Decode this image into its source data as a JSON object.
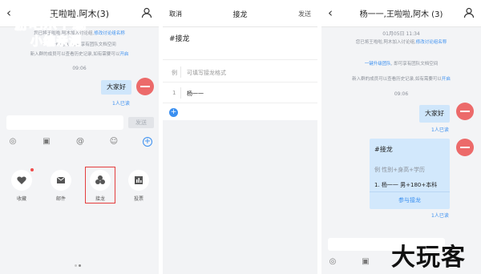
{
  "watermark": {
    "line1": "游吧乐下载",
    "line2": "小编亲测",
    "corner": "大玩客"
  },
  "panel1": {
    "title": "王啦啦,阿木(3)",
    "sys1": "您已将王啦啦,阿木加入讨论组,",
    "sys1_link": "修改讨论组名称",
    "sys2": "一键升级团队, 即可享有团队文档空间",
    "sys3": "新入群的成员可以查看历史记录,如有需要可以",
    "sys3_link": "开启",
    "time": "09:06",
    "message": "大家好",
    "read": "1人已读",
    "send": "发送",
    "features": [
      {
        "icon": "heart-icon",
        "label": "收藏"
      },
      {
        "icon": "mail-icon",
        "label": "邮件"
      },
      {
        "icon": "relay-icon",
        "label": "接龙"
      },
      {
        "icon": "vote-icon",
        "label": "投票"
      }
    ]
  },
  "panel2": {
    "cancel": "取消",
    "title": "接龙",
    "send": "发送",
    "heading": "#接龙",
    "example_prefix": "例",
    "example_placeholder": "可填写接龙格式",
    "row_number": "1",
    "row_value": "杨一一"
  },
  "panel3": {
    "title": "杨一一,王啦啦,阿木 (3)",
    "timestamp": "01月05日 11:34",
    "sys1": "您已将王啦啦,阿木加入讨论组,",
    "sys1_link": "修改讨论组名称",
    "sys2a": "一键升级团队",
    "sys2b": ", 即可享有团队文档空间",
    "sys3": "新入群的成员可以查看历史记录,如有需要可以",
    "sys3_link": "开启",
    "time": "09:06",
    "message": "大家好",
    "read1": "1人已读",
    "relay_title": "#接龙",
    "relay_example": "例 性别+身高+学历",
    "relay_entry": "1. 杨一一 男+180+本科",
    "relay_join": "参与接龙",
    "read2": "1人已读"
  }
}
